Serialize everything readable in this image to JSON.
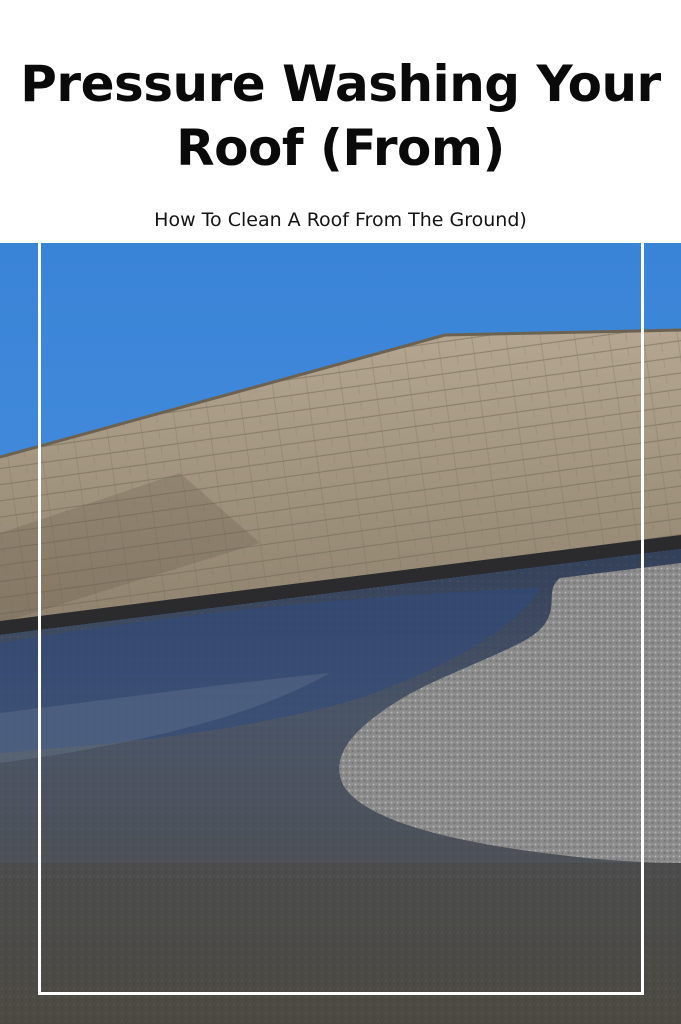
{
  "header": {
    "title": "Pressure Washing Your Roof (From)",
    "subtitle": "How To Clean A Roof From The Ground)"
  },
  "photo": {
    "subject": "asphalt-shingle-roof",
    "colors": {
      "sky": "#3d87d8",
      "shingles": "#a79882",
      "wet_surface": "#3d4654",
      "clean_patch": "#8c8c8c",
      "frame": "#ffffff"
    }
  }
}
